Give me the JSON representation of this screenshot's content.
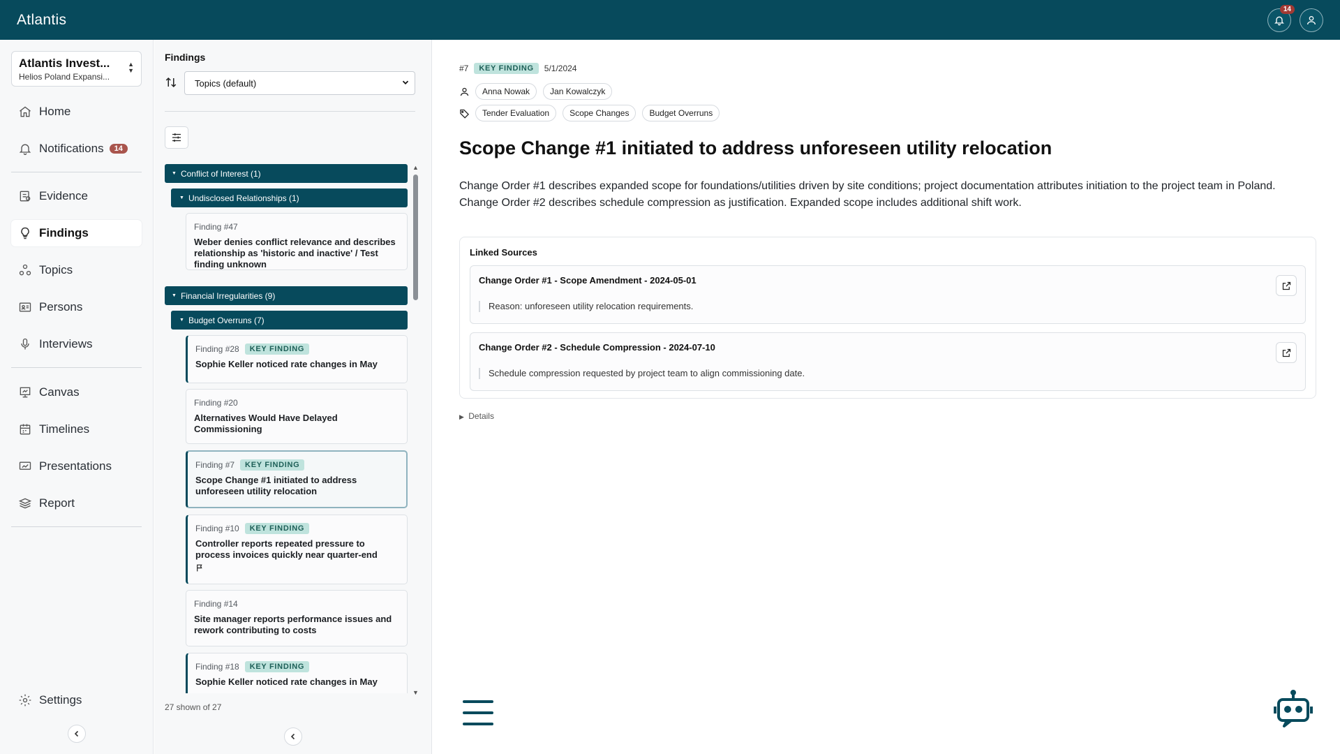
{
  "app": {
    "logo": "Atlantis",
    "notification_count": "14"
  },
  "workspace": {
    "title": "Atlantis Invest...",
    "subtitle": "Helios Poland Expansi..."
  },
  "nav": {
    "home": "Home",
    "notifications": "Notifications",
    "notifications_count": "14",
    "evidence": "Evidence",
    "findings": "Findings",
    "topics": "Topics",
    "persons": "Persons",
    "interviews": "Interviews",
    "canvas": "Canvas",
    "timelines": "Timelines",
    "presentations": "Presentations",
    "report": "Report",
    "settings": "Settings"
  },
  "findings_list": {
    "title": "Findings",
    "sort_value": "Topics (default)",
    "count_text": "27 shown of 27",
    "groups": {
      "conflict": "Conflict of Interest (1)",
      "undisclosed": "Undisclosed Relationships (1)",
      "financial": "Financial Irregularities (9)",
      "budget": "Budget Overruns (7)"
    },
    "key_label": "KEY FINDING",
    "items": [
      {
        "id": "Finding #47",
        "title": "Weber denies conflict relevance and describes relationship as 'historic and inactive' / Test finding unknown"
      },
      {
        "id": "Finding #28",
        "title": "Sophie Keller noticed rate changes in May"
      },
      {
        "id": "Finding #20",
        "title": "Alternatives Would Have Delayed Commissioning"
      },
      {
        "id": "Finding #7",
        "title": "Scope Change #1 initiated to address unforeseen utility relocation"
      },
      {
        "id": "Finding #10",
        "title": "Controller reports repeated pressure to process invoices quickly near quarter-end"
      },
      {
        "id": "Finding #14",
        "title": "Site manager reports performance issues and rework contributing to costs"
      },
      {
        "id": "Finding #18",
        "title": "Sophie Keller noticed rate changes in May"
      }
    ]
  },
  "detail": {
    "number": "#7",
    "key_label": "KEY FINDING",
    "date": "5/1/2024",
    "persons": [
      "Anna Nowak",
      "Jan Kowalczyk"
    ],
    "tags": [
      "Tender Evaluation",
      "Scope Changes",
      "Budget Overruns"
    ],
    "title": "Scope Change #1 initiated to address unforeseen utility relocation",
    "description_line1": "Change Order #1 describes expanded scope for foundations/utilities driven by site conditions; project documentation attributes initiation to the project team in Poland.",
    "description_line2": "Change Order #2 describes schedule compression as justification. Expanded scope includes additional shift work.",
    "linked_sources_title": "Linked Sources",
    "sources": [
      {
        "title": "Change Order #1 - Scope Amendment - 2024-05-01",
        "quote": "Reason: unforeseen utility relocation requirements."
      },
      {
        "title": "Change Order #2 - Schedule Compression - 2024-07-10",
        "quote": "Schedule compression requested by project team to align commissioning date."
      }
    ],
    "details_label": "Details"
  },
  "colors": {
    "brand": "#074a5c",
    "badge_red": "#a33a34",
    "key_badge_bg": "#bfe3dd"
  },
  "icons": [
    "bell-icon",
    "user-icon",
    "home-icon",
    "evidence-icon",
    "lightbulb-icon",
    "topics-icon",
    "persons-icon",
    "microphone-icon",
    "canvas-icon",
    "calendar-icon",
    "presentation-icon",
    "report-icon",
    "gear-icon",
    "sort-icon",
    "filter-icon",
    "flag-icon",
    "external-link-icon",
    "menu-icon",
    "bot-icon",
    "tag-icon"
  ]
}
